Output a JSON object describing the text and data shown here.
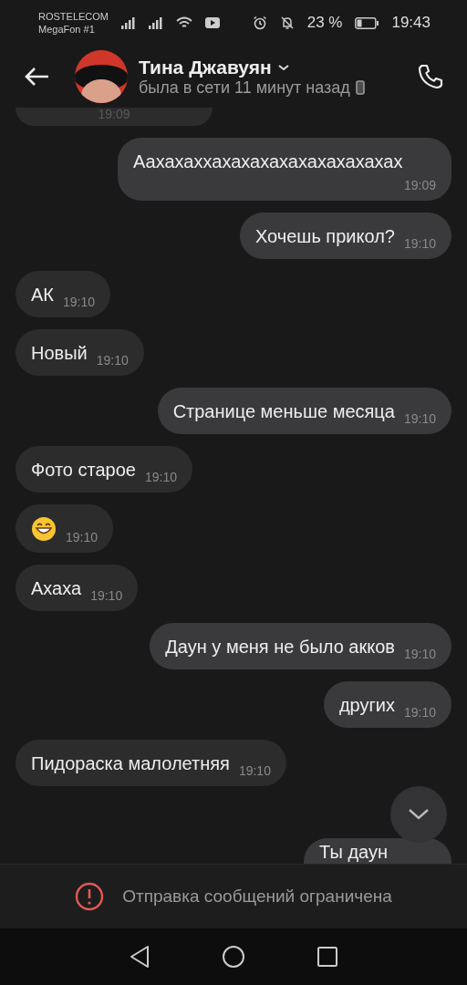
{
  "status_bar": {
    "carriers": [
      "ROSTELECOM",
      "MegaFon #1"
    ],
    "battery": "23 %",
    "time": "19:43"
  },
  "header": {
    "name": "Тина Джавуян",
    "status": "была в сети 11 минут назад"
  },
  "messages": [
    {
      "outgoing": false,
      "kind": "cut",
      "time": "19:09"
    },
    {
      "outgoing": true,
      "kind": "text",
      "text": "Аахахаххахахахахахахахахахах",
      "time": "19:09"
    },
    {
      "outgoing": true,
      "kind": "text",
      "text": "Хочешь прикол?",
      "time": "19:10"
    },
    {
      "outgoing": false,
      "kind": "text",
      "text": "АК",
      "time": "19:10"
    },
    {
      "outgoing": false,
      "kind": "text",
      "text": "Новый",
      "time": "19:10"
    },
    {
      "outgoing": true,
      "kind": "text",
      "text": "Странице меньше месяца",
      "time": "19:10"
    },
    {
      "outgoing": false,
      "kind": "text",
      "text": "Фото старое",
      "time": "19:10"
    },
    {
      "outgoing": false,
      "kind": "emoji",
      "time": "19:10"
    },
    {
      "outgoing": false,
      "kind": "text",
      "text": "Ахаха",
      "time": "19:10"
    },
    {
      "outgoing": true,
      "kind": "text",
      "text": "Даун у меня не было акков",
      "time": "19:10"
    },
    {
      "outgoing": true,
      "kind": "text",
      "text": "других",
      "time": "19:10"
    },
    {
      "outgoing": false,
      "kind": "text",
      "text": "Пидораска малолетняя",
      "time": "19:10"
    },
    {
      "outgoing": true,
      "kind": "tail",
      "text": "Ты даун"
    }
  ],
  "notice": "Отправка сообщений ограничена"
}
